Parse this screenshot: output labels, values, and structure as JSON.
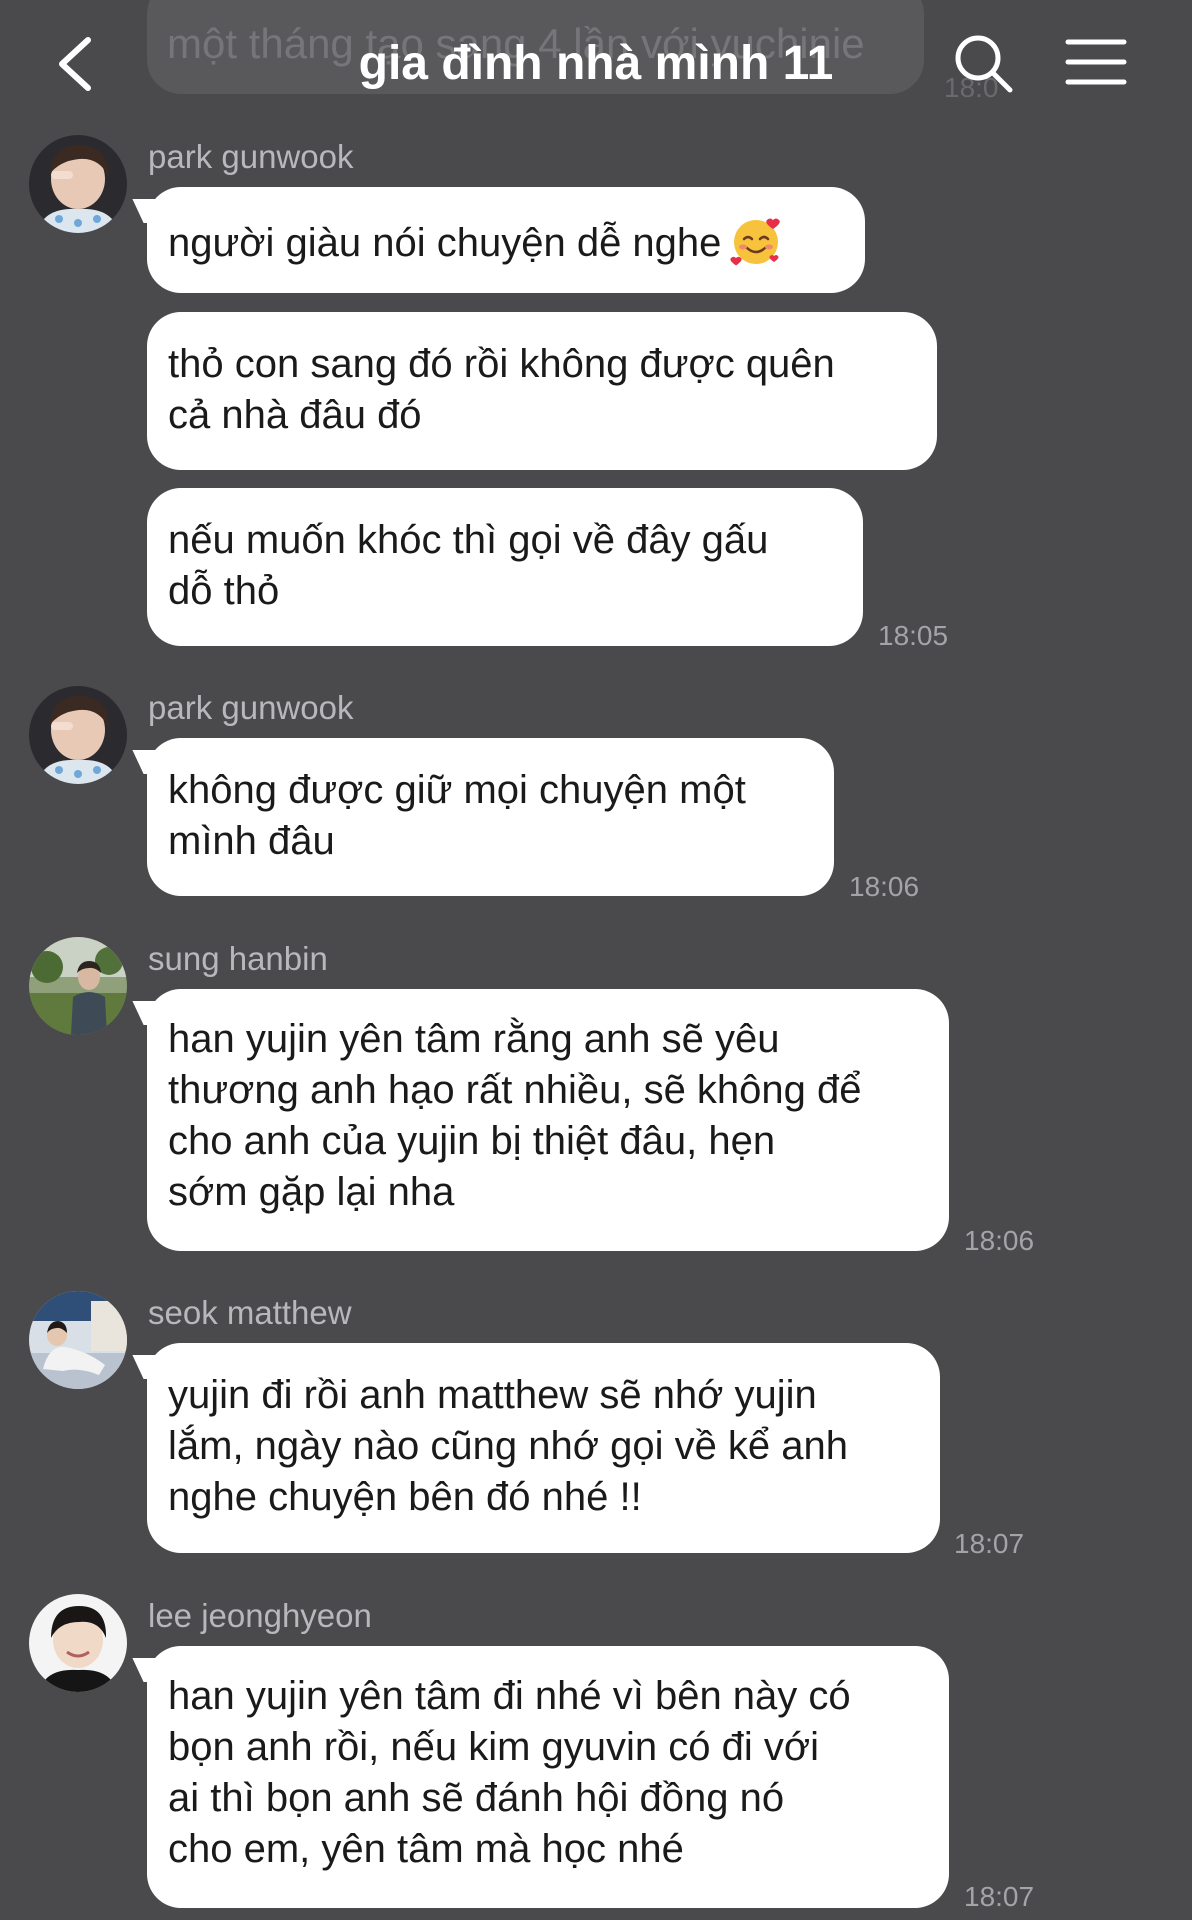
{
  "header": {
    "title": "gia đình nhà mình 11",
    "background_preview": "một tháng tạo sang 4 lần với yuchinie",
    "background_time": "18:0"
  },
  "messages": [
    {
      "sender": "park gunwook",
      "lines": [
        "người giàu nói chuyện dễ nghe"
      ],
      "emoji": "smiling-face-with-hearts-icon",
      "time": ""
    },
    {
      "sender": "",
      "lines": [
        "thỏ con sang đó rồi không được quên\ncả nhà đâu đó"
      ],
      "time": ""
    },
    {
      "sender": "",
      "lines": [
        "nếu muốn khóc thì gọi về đây gấu\ndỗ thỏ"
      ],
      "time": "18:05"
    },
    {
      "sender": "park gunwook",
      "lines": [
        "không được giữ mọi chuyện một\nmình đâu"
      ],
      "time": "18:06"
    },
    {
      "sender": "sung hanbin",
      "lines": [
        "han yujin yên tâm rằng anh sẽ yêu\nthương anh hạo rất nhiều, sẽ không để\ncho anh của yujin bị thiệt đâu, hẹn\nsớm gặp lại nha"
      ],
      "time": "18:06"
    },
    {
      "sender": "seok matthew",
      "lines": [
        "yujin đi rồi anh matthew sẽ nhớ yujin\nlắm, ngày nào cũng nhớ gọi về kể anh\nnghe chuyện bên đó nhé !!"
      ],
      "time": "18:07"
    },
    {
      "sender": "lee jeonghyeon",
      "lines": [
        "han yujin yên tâm đi nhé vì bên này có\nbọn anh rồi, nếu kim gyuvin có đi với\nai thì bọn anh sẽ đánh hội đồng nó\ncho em, yên tâm mà học nhé"
      ],
      "time": "18:07"
    }
  ],
  "colors": {
    "background": "#4a494c",
    "bubble": "#ffffff",
    "sender_name": "#b8b7bb",
    "timestamp": "#a4a3a8"
  }
}
